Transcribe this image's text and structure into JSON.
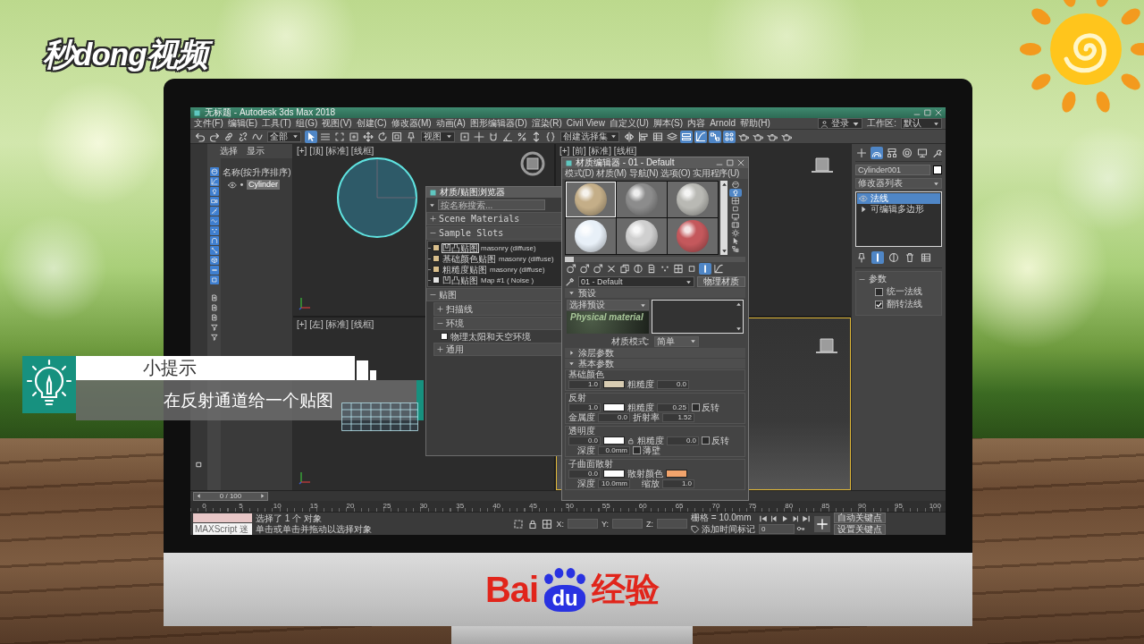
{
  "logo": {
    "text": "秒dong视频"
  },
  "app": {
    "title": "无标题 - Autodesk 3ds Max 2018",
    "menu": [
      "文件(F)",
      "编辑(E)",
      "工具(T)",
      "组(G)",
      "视图(V)",
      "创建(C)",
      "修改器(M)",
      "动画(A)",
      "图形编辑器(D)",
      "渲染(R)",
      "Civil View",
      "自定义(U)",
      "脚本(S)",
      "内容",
      "Arnold",
      "帮助(H)"
    ],
    "account": "登录",
    "workspace_label": "工作区:",
    "workspace": "默认",
    "toolbar": [
      {
        "kind": "button",
        "on": false
      },
      {
        "kind": "button",
        "on": false
      },
      {
        "kind": "button",
        "on": false
      },
      {
        "kind": "button",
        "on": false
      },
      {
        "kind": "button",
        "on": false
      },
      {
        "kind": "dropdown",
        "value": "全部"
      },
      {
        "kind": "button",
        "on": true
      },
      {
        "kind": "button",
        "on": false
      },
      {
        "kind": "button",
        "on": false
      },
      {
        "kind": "button",
        "on": false
      },
      {
        "kind": "button",
        "on": false
      },
      {
        "kind": "button",
        "on": false
      },
      {
        "kind": "button",
        "on": false
      },
      {
        "kind": "button",
        "on": false
      },
      {
        "kind": "dropdown",
        "value": "视图"
      },
      {
        "kind": "button",
        "on": false
      },
      {
        "kind": "button",
        "on": false
      },
      {
        "kind": "button",
        "on": false
      },
      {
        "kind": "button",
        "on": false
      },
      {
        "kind": "button",
        "on": false
      },
      {
        "kind": "button",
        "on": false
      },
      {
        "kind": "button",
        "on": false
      },
      {
        "kind": "dropdown",
        "value": "创建选择集"
      },
      {
        "kind": "button",
        "on": false
      },
      {
        "kind": "button",
        "on": false
      },
      {
        "kind": "button",
        "on": false
      },
      {
        "kind": "button",
        "on": false
      },
      {
        "kind": "button",
        "on": true
      },
      {
        "kind": "button",
        "on": true
      },
      {
        "kind": "button",
        "on": true
      },
      {
        "kind": "button",
        "on": true
      },
      {
        "kind": "button",
        "on": false
      },
      {
        "kind": "button",
        "on": false
      },
      {
        "kind": "button",
        "on": false
      },
      {
        "kind": "button",
        "on": false
      }
    ],
    "scene_explorer": {
      "menu": [
        "选择",
        "显示"
      ],
      "filters": [
        {
          "on": true
        },
        {
          "on": true
        },
        {
          "on": true
        },
        {
          "on": true
        },
        {
          "on": true
        },
        {
          "on": true
        },
        {
          "on": true
        },
        {
          "on": true
        },
        {
          "on": true
        },
        {
          "on": true
        },
        {
          "on": true
        },
        {
          "on": true
        }
      ],
      "column": "名称(按升序排序)",
      "items": [
        {
          "name": "Cylinder",
          "selected": true
        }
      ]
    },
    "viewports": [
      {
        "label": "[+] [顶] [标准] [线框]",
        "active": false
      },
      {
        "label": "[+] [前] [标准] [线框]",
        "active": false
      },
      {
        "label": "[+] [左] [标准] [线框]",
        "active": false
      },
      {
        "active": true
      }
    ],
    "command_panel": {
      "tabs": [
        {
          "selected": false
        },
        {
          "selected": true
        },
        {
          "selected": false
        },
        {
          "selected": false
        },
        {
          "selected": false
        },
        {
          "selected": false
        }
      ],
      "object_name": "Cylinder001",
      "modifier_list": "修改器列表",
      "stack": [
        {
          "kind": "modifier",
          "name": "法线",
          "selected": true
        },
        {
          "kind": "object",
          "name": "可编辑多边形",
          "selected": false
        }
      ],
      "stack_tools": [
        {
          "on": false
        },
        {
          "on": true
        },
        {
          "on": false
        },
        {
          "on": false
        },
        {
          "on": false
        }
      ],
      "rollout": {
        "title": "参数",
        "expanded": true,
        "options": [
          {
            "label": "统一法线",
            "checked": false
          },
          {
            "label": "翻转法线",
            "checked": true
          }
        ]
      }
    },
    "material_browser": {
      "title": "材质/贴图浏览器",
      "search": {
        "placeholder": "按名称搜索..."
      },
      "groups": [
        {
          "label": "Scene Materials",
          "expanded": false
        },
        {
          "label": "Sample Slots",
          "expanded": true,
          "items": [
            {
              "name": "凹凸贴图",
              "detail": "masonry (diffuse)",
              "color": "#d9bf8c",
              "selected": true
            },
            {
              "name": "基础颜色贴图",
              "detail": "masonry (diffuse)",
              "color": "#d9bf8c",
              "selected": false
            },
            {
              "name": "粗糙度贴图",
              "detail": "masonry (diffuse)",
              "color": "#d9bf8c",
              "selected": false
            },
            {
              "name": "凹凸贴图",
              "detail": "Map #1 ( Noise )",
              "color": "#e4e4e4",
              "selected": false
            }
          ]
        },
        {
          "label": "贴图",
          "expanded": true,
          "children": [
            {
              "label": "扫描线",
              "expanded": false
            },
            {
              "label": "环境",
              "expanded": true,
              "items": [
                {
                  "name": "物理太阳和天空环境",
                  "color": "#ffffff",
                  "selected": false
                }
              ]
            },
            {
              "label": "通用",
              "expanded": false
            }
          ]
        }
      ]
    },
    "material_editor": {
      "title": "材质编辑器 - 01 - Default",
      "menu": [
        "模式(D)",
        "材质(M)",
        "导航(N)",
        "选项(O)",
        "实用程序(U)"
      ],
      "slots": [
        {
          "color": "#c4ae88",
          "selected": true
        },
        {
          "color": "#8c8c8c",
          "selected": false
        },
        {
          "color": "#b9b9b4",
          "selected": false
        },
        {
          "color": "#e8f0f8",
          "selected": false
        },
        {
          "color": "#cfcfcf",
          "selected": false
        },
        {
          "color": "#c4585c",
          "selected": false
        }
      ],
      "side_tools": [
        {
          "on": false
        },
        {
          "on": true
        },
        {
          "on": false
        },
        {
          "on": false
        },
        {
          "on": false
        },
        {
          "on": false
        },
        {
          "on": false
        },
        {
          "on": false
        },
        {
          "on": false
        }
      ],
      "tools": [
        {
          "on": false
        },
        {
          "on": false
        },
        {
          "on": false
        },
        {
          "on": false
        },
        {
          "on": false
        },
        {
          "on": false
        },
        {
          "on": false
        },
        {
          "on": false
        },
        {
          "on": false
        },
        {
          "on": false
        },
        {
          "on": true
        },
        {
          "on": false
        }
      ],
      "material_name": "01 - Default",
      "material_type": "物理材质",
      "rollouts": [
        {
          "title": "预设",
          "expanded": true,
          "preset": "选择预设",
          "thumbnail": "Physical material",
          "mode_label": "材质模式:",
          "mode": "简单"
        },
        {
          "title": "涂层参数",
          "expanded": false
        },
        {
          "title": "基本参数",
          "expanded": true,
          "groups": [
            {
              "title": "基础颜色",
              "rows": [
                [
                  {
                    "kind": "spinner",
                    "value": "1.0"
                  },
                  {
                    "kind": "swatch",
                    "color": "#d8ccb2"
                  },
                  {
                    "kind": "label",
                    "text": "粗糙度"
                  },
                  {
                    "kind": "spinner",
                    "value": "0.0"
                  }
                ]
              ]
            },
            {
              "title": "反射",
              "rows": [
                [
                  {
                    "kind": "spinner",
                    "value": "1.0"
                  },
                  {
                    "kind": "swatch",
                    "color": "#ffffff"
                  },
                  {
                    "kind": "label",
                    "text": "粗糙度"
                  },
                  {
                    "kind": "spinner",
                    "value": "0.25"
                  },
                  {
                    "kind": "check",
                    "label": "反转",
                    "checked": false
                  }
                ],
                [
                  {
                    "kind": "label",
                    "text": "金属度"
                  },
                  {
                    "kind": "spinner",
                    "value": "0.0"
                  },
                  {
                    "kind": "label",
                    "text": "折射率"
                  },
                  {
                    "kind": "spinner",
                    "value": "1.52"
                  }
                ]
              ]
            },
            {
              "title": "透明度",
              "rows": [
                [
                  {
                    "kind": "spinner",
                    "value": "0.0"
                  },
                  {
                    "kind": "swatch",
                    "color": "#ffffff"
                  },
                  {
                    "kind": "lock"
                  },
                  {
                    "kind": "label",
                    "text": "粗糙度"
                  },
                  {
                    "kind": "spinner",
                    "value": "0.0"
                  },
                  {
                    "kind": "check",
                    "label": "反转",
                    "checked": false
                  }
                ],
                [
                  {
                    "kind": "label",
                    "text": "深度"
                  },
                  {
                    "kind": "spinner",
                    "value": "0.0mm"
                  },
                  {
                    "kind": "check",
                    "label": "薄壁",
                    "checked": false
                  }
                ]
              ]
            },
            {
              "title": "子曲面散射",
              "rows": [
                [
                  {
                    "kind": "spinner",
                    "value": "0.0"
                  },
                  {
                    "kind": "swatch",
                    "color": "#ffffff"
                  },
                  {
                    "kind": "label",
                    "text": "散射颜色"
                  },
                  {
                    "kind": "swatch",
                    "color": "#f2a46c"
                  }
                ],
                [
                  {
                    "kind": "label",
                    "text": "深度"
                  },
                  {
                    "kind": "spinner",
                    "value": "10.0mm"
                  },
                  {
                    "kind": "label",
                    "text": "缩放"
                  },
                  {
                    "kind": "spinner",
                    "value": "1.0"
                  }
                ]
              ]
            }
          ]
        }
      ]
    },
    "time_slider": {
      "label": "0 / 100",
      "level": 0
    },
    "ruler": [
      "0",
      "5",
      "10",
      "15",
      "20",
      "25",
      "30",
      "35",
      "40",
      "45",
      "50",
      "55",
      "60",
      "65",
      "70",
      "75",
      "80",
      "85",
      "90",
      "95",
      "100"
    ],
    "status": {
      "script_label": "MAXScript 迷",
      "prompt": "选择了 1 个 对象",
      "hint": "单击或单击并拖动以选择对象",
      "axes": [
        "X:",
        "Y:",
        "Z:"
      ],
      "grid": "栅格 = 10.0mm",
      "time_tag": "添加时间标记",
      "frame": "0",
      "auto_key": "自动关键点",
      "set_key": "设置关键点"
    }
  },
  "tip": {
    "title": "小提示",
    "message": "在反射通道给一个贴图"
  },
  "brand": {
    "left": "Bai",
    "badge": "du",
    "right": "经验"
  }
}
